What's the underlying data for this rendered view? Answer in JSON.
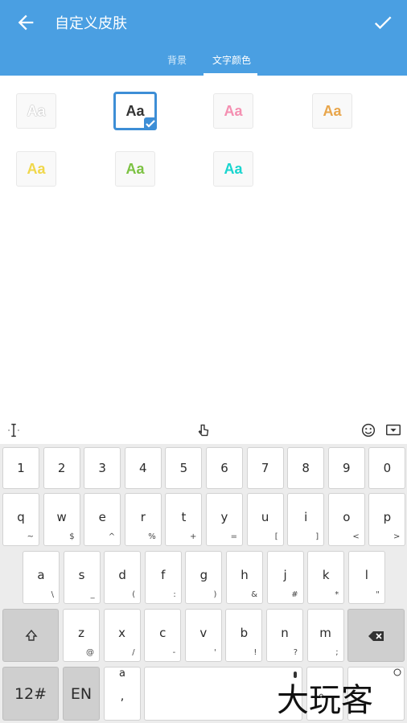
{
  "header": {
    "title": "自定义皮肤"
  },
  "tabs": [
    {
      "label": "背景"
    },
    {
      "label": "文字颜色"
    }
  ],
  "swatch_text": "Aa",
  "swatches": [
    {
      "color": "#ffffff"
    },
    {
      "color": "#333333",
      "selected": true
    },
    {
      "color": "#f48fb1"
    },
    {
      "color": "#e8a54a"
    },
    {
      "color": "#f0d74a"
    },
    {
      "color": "#7cc242"
    },
    {
      "color": "#19d5cf"
    }
  ],
  "keyboard": {
    "row1": [
      "1",
      "2",
      "3",
      "4",
      "5",
      "6",
      "7",
      "8",
      "9",
      "0"
    ],
    "row2": [
      {
        "m": "q",
        "s": "~"
      },
      {
        "m": "w",
        "s": "$"
      },
      {
        "m": "e",
        "s": "^"
      },
      {
        "m": "r",
        "s": "%"
      },
      {
        "m": "t",
        "s": "+"
      },
      {
        "m": "y",
        "s": "="
      },
      {
        "m": "u",
        "s": "["
      },
      {
        "m": "i",
        "s": "]"
      },
      {
        "m": "o",
        "s": "<"
      },
      {
        "m": "p",
        "s": ">"
      }
    ],
    "row3": [
      {
        "m": "a",
        "s": "\\"
      },
      {
        "m": "s",
        "s": "_"
      },
      {
        "m": "d",
        "s": "("
      },
      {
        "m": "f",
        "s": ":"
      },
      {
        "m": "g",
        "s": ")"
      },
      {
        "m": "h",
        "s": "&"
      },
      {
        "m": "j",
        "s": "#"
      },
      {
        "m": "k",
        "s": "*"
      },
      {
        "m": "l",
        "s": "\""
      }
    ],
    "row4": [
      {
        "m": "z",
        "s": "@"
      },
      {
        "m": "x",
        "s": "/"
      },
      {
        "m": "c",
        "s": "-"
      },
      {
        "m": "v",
        "s": "'"
      },
      {
        "m": "b",
        "s": "!"
      },
      {
        "m": "n",
        "s": "?"
      },
      {
        "m": "m",
        "s": ";"
      }
    ],
    "num_label": "12#",
    "lang_label": "EN",
    "comma_key": {
      "top": "a",
      "bottom": ","
    },
    "dot_label": "。"
  },
  "watermark": "大玩客",
  "colors": {
    "accent": "#4a9fe2",
    "selected": "#3d8ed6"
  }
}
